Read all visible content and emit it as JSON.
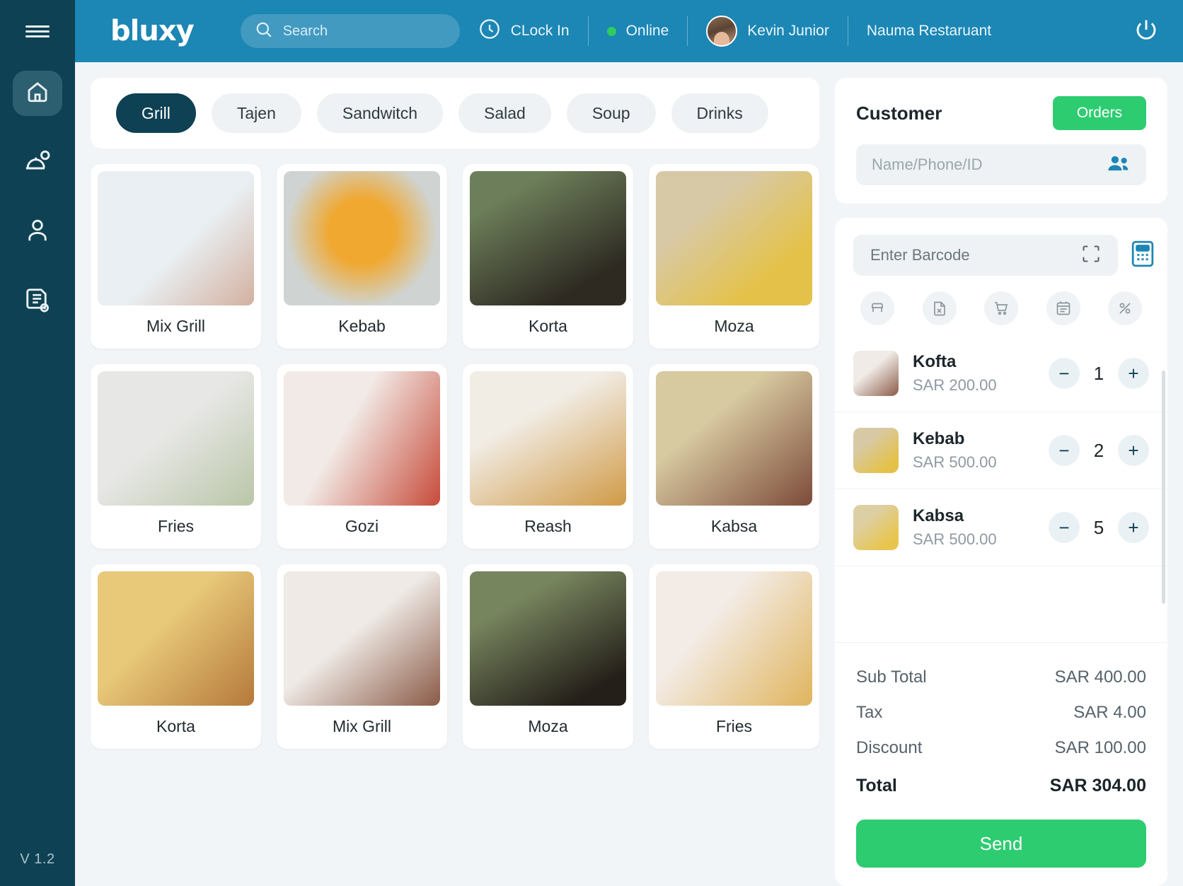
{
  "app": {
    "logo": "bluxy",
    "version": "V 1.2"
  },
  "header": {
    "search_placeholder": "Search",
    "clock_in": "CLock In",
    "status": "Online",
    "user": "Kevin Junior",
    "restaurant": "Nauma Restaruant",
    "accent": "#1c86b4",
    "status_color": "#2ecc5f"
  },
  "sidebar": {
    "items": [
      {
        "name": "home",
        "active": true
      },
      {
        "name": "menu-dome",
        "active": false
      },
      {
        "name": "customer",
        "active": false
      },
      {
        "name": "reports",
        "active": false
      }
    ]
  },
  "categories": [
    {
      "label": "Grill",
      "active": true
    },
    {
      "label": "Tajen",
      "active": false
    },
    {
      "label": "Sandwitch",
      "active": false
    },
    {
      "label": "Salad",
      "active": false
    },
    {
      "label": "Soup",
      "active": false
    },
    {
      "label": "Drinks",
      "active": false
    }
  ],
  "products": [
    {
      "name": "Mix Grill"
    },
    {
      "name": "Kebab"
    },
    {
      "name": "Korta"
    },
    {
      "name": "Moza"
    },
    {
      "name": "Fries"
    },
    {
      "name": "Gozi"
    },
    {
      "name": "Reash"
    },
    {
      "name": "Kabsa"
    },
    {
      "name": "Korta"
    },
    {
      "name": "Mix Grill"
    },
    {
      "name": "Moza"
    },
    {
      "name": "Fries"
    }
  ],
  "customer": {
    "title": "Customer",
    "orders_label": "Orders",
    "input_placeholder": "Name/Phone/ID",
    "orders_color": "#2ecc71"
  },
  "barcode": {
    "placeholder": "Enter Barcode"
  },
  "actions": [
    {
      "name": "table"
    },
    {
      "name": "void-order"
    },
    {
      "name": "cart"
    },
    {
      "name": "note"
    },
    {
      "name": "discount"
    }
  ],
  "cart_items": [
    {
      "name": "Kofta",
      "price": "SAR 200.00",
      "qty": "1"
    },
    {
      "name": "Kebab",
      "price": "SAR 500.00",
      "qty": "2"
    },
    {
      "name": "Kabsa",
      "price": "SAR 500.00",
      "qty": "5"
    }
  ],
  "totals": {
    "subtotal_label": "Sub Total",
    "subtotal_value": "SAR 400.00",
    "tax_label": "Tax",
    "tax_value": "SAR 4.00",
    "discount_label": "Discount",
    "discount_value": "SAR 100.00",
    "total_label": "Total",
    "total_value": "SAR 304.00"
  },
  "send_label": "Send"
}
